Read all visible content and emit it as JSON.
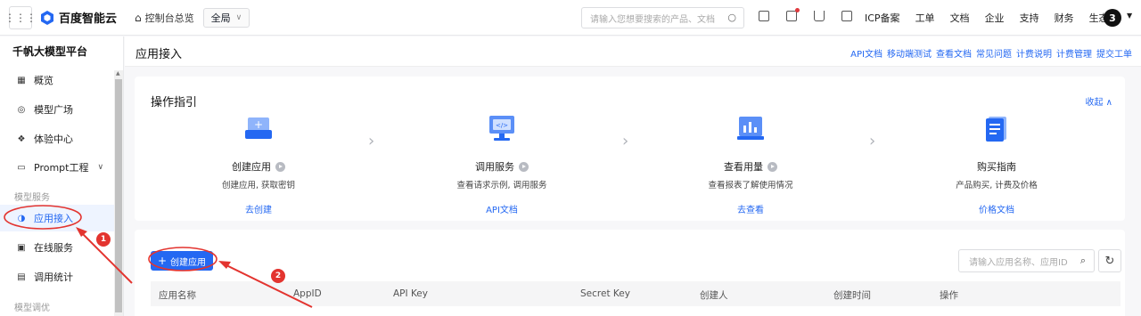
{
  "topbar": {
    "brand": "百度智能云",
    "home": "控制台总览",
    "region": "全局",
    "search_placeholder": "请输入您想要搜索的产品、文档",
    "nav": [
      "ICP备案",
      "工单",
      "文档",
      "企业",
      "支持",
      "财务",
      "生态"
    ],
    "avatar": "3"
  },
  "sidebar": {
    "title": "千帆大模型平台",
    "items": [
      {
        "label": "概览",
        "icon": "grid-icon"
      },
      {
        "label": "模型广场",
        "icon": "model-icon"
      },
      {
        "label": "体验中心",
        "icon": "cube-icon"
      },
      {
        "label": "Prompt工程",
        "icon": "prompt-icon"
      }
    ],
    "group1": "模型服务",
    "service_items": [
      {
        "label": "应用接入",
        "icon": "app-access-icon"
      },
      {
        "label": "在线服务",
        "icon": "service-icon"
      },
      {
        "label": "调用统计",
        "icon": "stats-icon"
      }
    ],
    "group2": "模型调优"
  },
  "header": {
    "title": "应用接入",
    "links": [
      "API文档",
      "移动端测试",
      "查看文档",
      "常见问题",
      "计费说明",
      "计费管理",
      "提交工单"
    ]
  },
  "guide": {
    "title": "操作指引",
    "collapse": "收起",
    "steps": [
      {
        "name": "创建应用",
        "desc": "创建应用, 获取密钥",
        "link": "去创建"
      },
      {
        "name": "调用服务",
        "desc": "查看请求示例, 调用服务",
        "link": "API文档"
      },
      {
        "name": "查看用量",
        "desc": "查看报表了解使用情况",
        "link": "去查看"
      },
      {
        "name": "购买指南",
        "desc": "产品购买, 计费及价格",
        "link": "价格文档"
      }
    ]
  },
  "apps": {
    "create_label": "创建应用",
    "search_placeholder": "请输入应用名称、应用ID",
    "columns": [
      "应用名称",
      "AppID",
      "API Key",
      "Secret Key",
      "创建人",
      "创建时间",
      "操作"
    ]
  },
  "annotations": {
    "badge1": "1",
    "badge2": "2"
  },
  "colors": {
    "accent": "#2468f2",
    "annotation": "#e3342f"
  }
}
